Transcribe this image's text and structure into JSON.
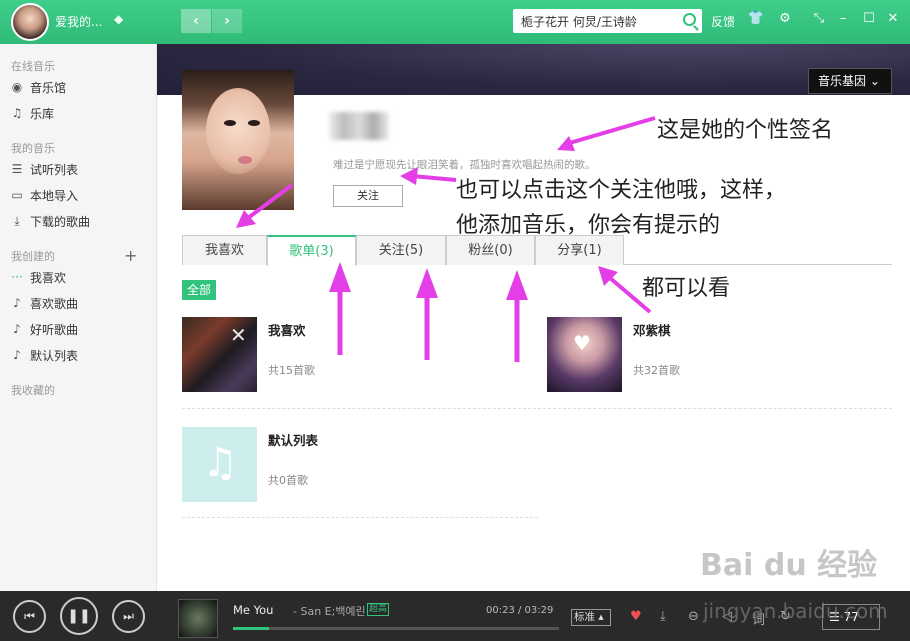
{
  "topbar": {
    "username": "爱我的...",
    "vip_icon": "diamond-icon",
    "back_icon": "chevron-left-icon",
    "forward_icon": "chevron-right-icon",
    "search_value": "栀子花开 何炅/王诗龄",
    "feedback": "反馈",
    "accent_color": "#31c27c"
  },
  "sidebar": {
    "online_section": "在线音乐",
    "online_items": [
      {
        "label": "音乐馆",
        "icon": "disc-icon"
      },
      {
        "label": "乐库",
        "icon": "headphones-icon"
      }
    ],
    "my_section": "我的音乐",
    "my_items": [
      {
        "label": "试听列表",
        "icon": "list-icon"
      },
      {
        "label": "本地导入",
        "icon": "monitor-icon"
      },
      {
        "label": "下载的歌曲",
        "icon": "download-icon"
      }
    ],
    "created_section": "我创建的",
    "created_items": [
      {
        "label": "我喜欢",
        "icon": "dots-icon"
      },
      {
        "label": "喜欢歌曲",
        "icon": "music-note-icon"
      },
      {
        "label": "好听歌曲",
        "icon": "music-note-icon"
      },
      {
        "label": "默认列表",
        "icon": "music-note-icon"
      }
    ],
    "collected_section": "我收藏的"
  },
  "profile": {
    "gene_button": "音乐基因",
    "signature": "难过是宁愿现先让眼泪笑着，孤独时喜欢唱起热闹的歌。",
    "follow_button": "关注"
  },
  "tabs": [
    {
      "label": "我喜欢"
    },
    {
      "label": "歌单(3)"
    },
    {
      "label": "关注(5)"
    },
    {
      "label": "粉丝(0)"
    },
    {
      "label": "分享(1)"
    }
  ],
  "filter_badge": "全部",
  "playlists": [
    {
      "title": "我喜欢",
      "count": "共15首歌"
    },
    {
      "title": "邓紫棋",
      "count": "共32首歌"
    },
    {
      "title": "默认列表",
      "count": "共0首歌"
    }
  ],
  "annotations": {
    "a1": "这是她的个性签名",
    "a2": "也可以点击这个关注他哦，这样，",
    "a3": "他添加音乐，你会有提示的",
    "a4": "都可以看"
  },
  "player": {
    "song": "Me You",
    "artist": "- San E;백예린",
    "hq_badge": "超高",
    "time": "00:23 / 03:29",
    "progress": 0.11,
    "quality": "标准",
    "playlist_count": "77"
  },
  "watermark": {
    "brand": "Bai du 经验",
    "site": "jingyan.baidu.com"
  }
}
